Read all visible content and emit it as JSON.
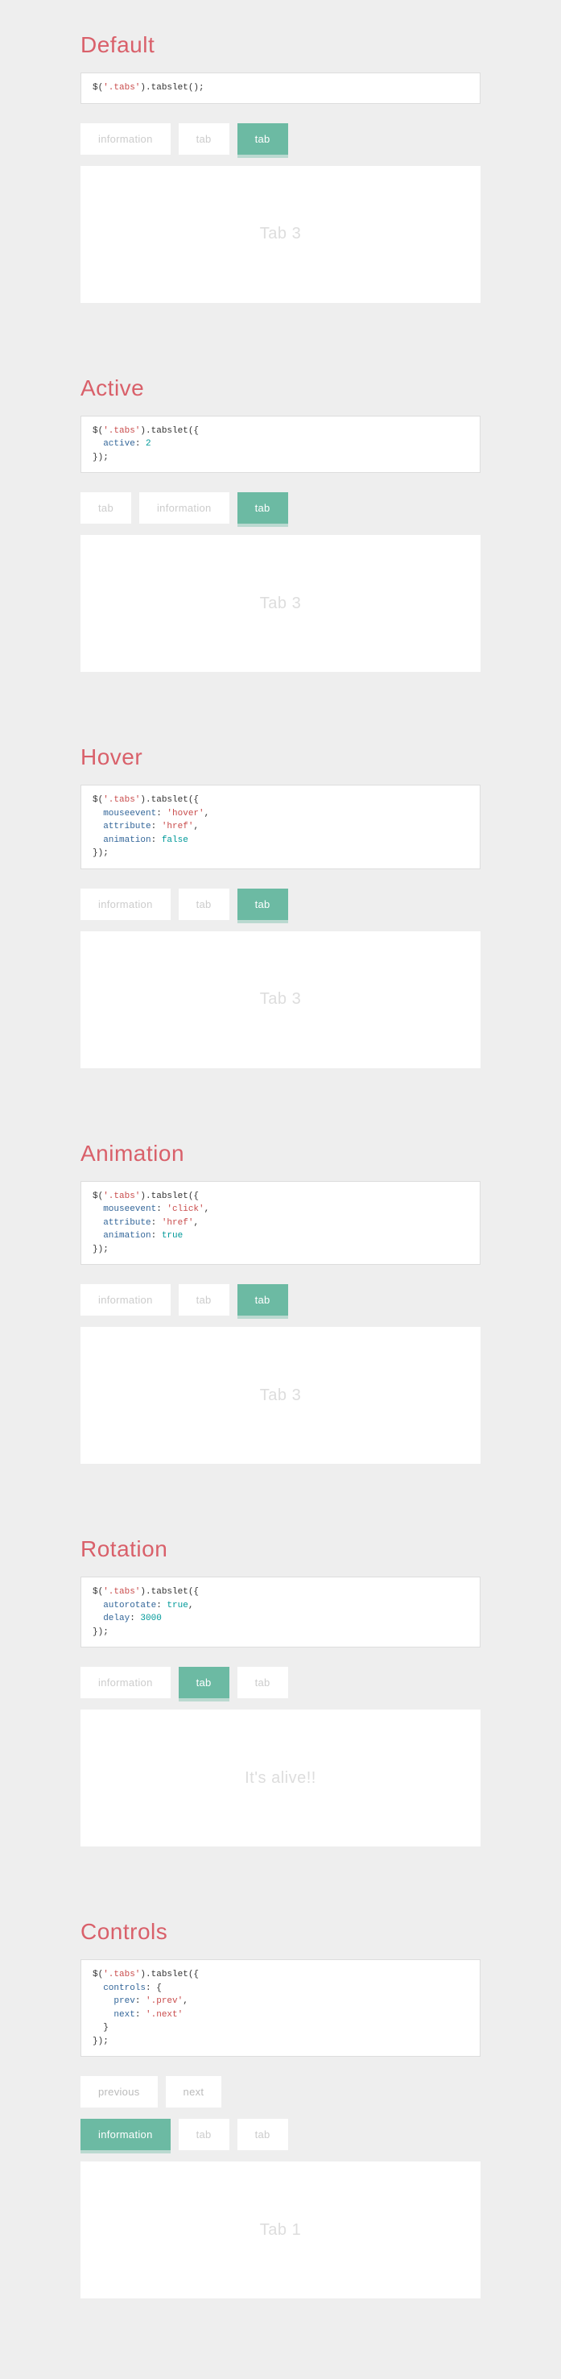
{
  "sections": [
    {
      "title": "Default",
      "code_html": "$(<span class=\"strlit\">'.tabs'</span>).tabslet();",
      "tabs": [
        {
          "label": "information",
          "active": false
        },
        {
          "label": "tab",
          "active": false
        },
        {
          "label": "tab",
          "active": true
        }
      ],
      "panel": "Tab 3"
    },
    {
      "title": "Active",
      "code_html": "$(<span class=\"strlit\">'.tabs'</span>).tabslet({\n  <span class=\"attr\">active</span>: <span class=\"num\">2</span>\n});",
      "tabs": [
        {
          "label": "tab",
          "active": false
        },
        {
          "label": "information",
          "active": false
        },
        {
          "label": "tab",
          "active": true
        }
      ],
      "panel": "Tab 3"
    },
    {
      "title": "Hover",
      "code_html": "$(<span class=\"strlit\">'.tabs'</span>).tabslet({\n  <span class=\"attr\">mouseevent</span>: <span class=\"val\">'hover'</span>,\n  <span class=\"attr\">attribute</span>: <span class=\"val\">'href'</span>,\n  <span class=\"attr\">animation</span>: <span class=\"bool\">false</span>\n});",
      "tabs": [
        {
          "label": "information",
          "active": false
        },
        {
          "label": "tab",
          "active": false
        },
        {
          "label": "tab",
          "active": true
        }
      ],
      "panel": "Tab 3"
    },
    {
      "title": "Animation",
      "code_html": "$(<span class=\"strlit\">'.tabs'</span>).tabslet({\n  <span class=\"attr\">mouseevent</span>: <span class=\"val\">'click'</span>,\n  <span class=\"attr\">attribute</span>: <span class=\"val\">'href'</span>,\n  <span class=\"attr\">animation</span>: <span class=\"bool\">true</span>\n});",
      "tabs": [
        {
          "label": "information",
          "active": false
        },
        {
          "label": "tab",
          "active": false
        },
        {
          "label": "tab",
          "active": true
        }
      ],
      "panel": "Tab 3"
    },
    {
      "title": "Rotation",
      "code_html": "$(<span class=\"strlit\">'.tabs'</span>).tabslet({\n  <span class=\"attr\">autorotate</span>: <span class=\"bool\">true</span>,\n  <span class=\"attr\">delay</span>: <span class=\"num\">3000</span>\n});",
      "tabs": [
        {
          "label": "information",
          "active": false
        },
        {
          "label": "tab",
          "active": true
        },
        {
          "label": "tab",
          "active": false
        }
      ],
      "panel": "It's alive!!"
    },
    {
      "title": "Controls",
      "code_html": "$(<span class=\"strlit\">'.tabs'</span>).tabslet({\n  <span class=\"attr\">controls</span>: {\n    <span class=\"attr\">prev</span>: <span class=\"val\">'.prev'</span>,\n    <span class=\"attr\">next</span>: <span class=\"val\">'.next'</span>\n  }\n});",
      "controls": [
        {
          "label": "previous"
        },
        {
          "label": "next"
        }
      ],
      "tabs": [
        {
          "label": "information",
          "active": true
        },
        {
          "label": "tab",
          "active": false
        },
        {
          "label": "tab",
          "active": false
        }
      ],
      "panel": "Tab 1"
    }
  ]
}
